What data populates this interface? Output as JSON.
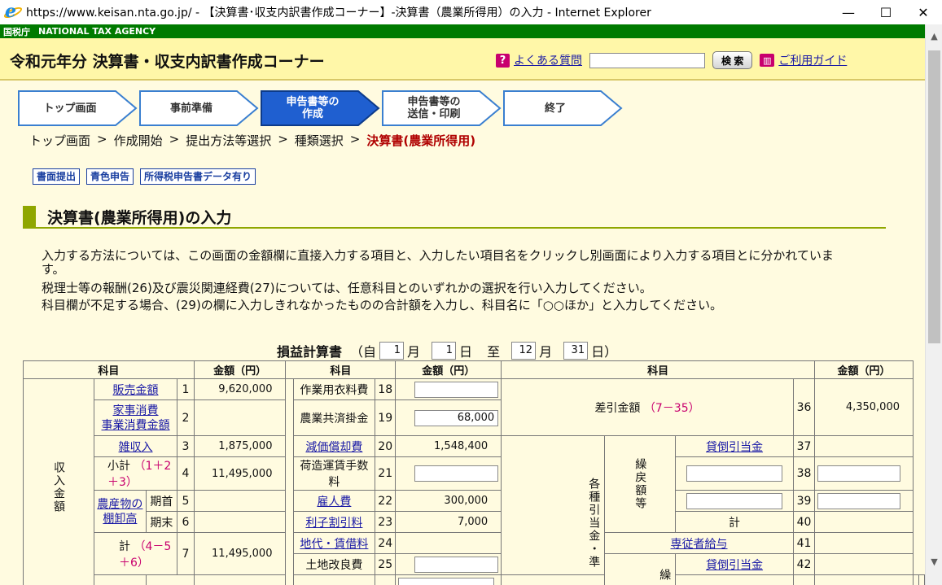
{
  "window": {
    "title": "https://www.keisan.nta.go.jp/ - 【決算書･収支内訳書作成コーナー】-決算書（農業所得用）の入力 - Internet Explorer",
    "minimize": "—",
    "maximize": "☐",
    "close": "✕"
  },
  "agency": {
    "kanji": "国税庁",
    "english": "NATIONAL TAX AGENCY"
  },
  "header": {
    "title": "令和元年分 決算書・収支内訳書作成コーナー",
    "faq_label": "よくある質問",
    "search_placeholder": "",
    "search_button": "検 索",
    "guide_label": "ご利用ガイド"
  },
  "steps": [
    {
      "label": "トップ画面",
      "active": false
    },
    {
      "label": "事前準備",
      "active": false
    },
    {
      "label": "申告書等の作成",
      "active": true
    },
    {
      "label": "申告書等の送信・印刷",
      "active": false
    },
    {
      "label": "終了",
      "active": false
    }
  ],
  "breadcrumb": {
    "items": [
      "トップ画面",
      "作成開始",
      "提出方法等選択",
      "種類選択"
    ],
    "current": "決算書(農業所得用)",
    "sep": ">"
  },
  "badges": [
    "書面提出",
    "青色申告",
    "所得税申告書データ有り"
  ],
  "section_title": "決算書(農業所得用)の入力",
  "instructions": [
    "入力する方法については、この画面の金額欄に直接入力する項目と、入力したい項目名をクリックし別画面により入力する項目とに分かれています。",
    "税理士等の報酬(26)及び震災関連経費(27)については、任意科目とのいずれかの選択を行い入力してください。",
    "科目欄が不足する場合、(29)の欄に入力しきれなかったものの合計額を入力し、科目名に「○○ほか」と入力してください。"
  ],
  "period": {
    "statement": "損益計算書",
    "open": "（自",
    "from_month": "1",
    "month": "月",
    "from_day": "1",
    "day": "日",
    "to": "至",
    "to_month": "12",
    "to_day": "31",
    "close": "日）"
  },
  "table": {
    "headers": {
      "item": "科目",
      "amount": "金額（円）"
    },
    "left": {
      "group_label": "収入金額",
      "sales": {
        "label": "販売金額",
        "no": "1",
        "amount": "9,620,000"
      },
      "home_use": {
        "label1": "家事消費",
        "label2": "事業消費金額",
        "no": "2",
        "amount": ""
      },
      "misc": {
        "label": "雑収入",
        "no": "3",
        "amount": "1,875,000"
      },
      "subtotal": {
        "label": "小計",
        "formula": "（1＋2＋3）",
        "no": "4",
        "amount": "11,495,000"
      },
      "inventory": {
        "label1": "農産物の",
        "label2": "棚卸高",
        "begin": "期首",
        "begin_no": "5",
        "end": "期末",
        "end_no": "6"
      },
      "total": {
        "label": "計",
        "formula": "（4－5＋6）",
        "no": "7",
        "amount": "11,495,000"
      }
    },
    "middle": [
      {
        "label": "作業用衣料費",
        "no": "18",
        "amount": "",
        "input": true,
        "link": false
      },
      {
        "label": "農業共済掛金",
        "no": "19",
        "amount": "68,000",
        "input": true,
        "link": false
      },
      {
        "label": "減価償却費",
        "no": "20",
        "amount": "1,548,400",
        "input": false,
        "link": true
      },
      {
        "label": "荷造運賃手数料",
        "no": "21",
        "amount": "",
        "input": true,
        "link": false
      },
      {
        "label": "雇人費",
        "no": "22",
        "amount": "300,000",
        "input": false,
        "link": true
      },
      {
        "label": "利子割引料",
        "no": "23",
        "amount": "7,000",
        "input": false,
        "link": true
      },
      {
        "label": "地代・賃借料",
        "no": "24",
        "amount": "",
        "input": false,
        "link": true
      },
      {
        "label": "土地改良費",
        "no": "25",
        "amount": "",
        "input": true,
        "link": false
      }
    ],
    "right": {
      "diff": {
        "label": "差引金額",
        "formula": "（7－35）",
        "no": "36",
        "amount": "4,350,000"
      },
      "group_outer": "各種引当金・準",
      "group_inner": "繰戻額等",
      "allowance": {
        "label": "貸倒引当金",
        "no": "37"
      },
      "blank1_no": "38",
      "blank2_no": "39",
      "subtotal": {
        "label": "計",
        "no": "40"
      },
      "family": {
        "label": "専従者給与",
        "no": "41"
      },
      "allowance2": {
        "label": "貸倒引当金",
        "no": "42"
      },
      "inner2": "繰"
    }
  },
  "colors": {
    "agency_green": "#007a00",
    "header_yellow": "#fff7a8",
    "page_bg": "#fffbe0",
    "active_step": "#1f5fd0",
    "accent_pink": "#c8006e"
  }
}
